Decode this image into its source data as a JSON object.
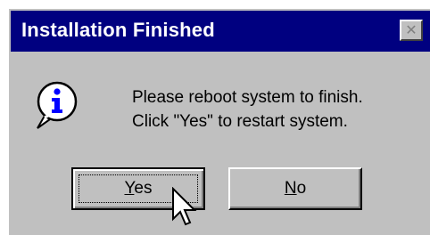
{
  "dialog": {
    "title": "Installation Finished",
    "close_glyph": "✕",
    "icon": "information-icon",
    "message_lines": [
      "Please reboot system to finish.",
      "Click \"Yes\" to restart system."
    ],
    "buttons": {
      "yes": {
        "mnemonic": "Y",
        "rest": "es"
      },
      "no": {
        "mnemonic": "N",
        "rest": "o"
      }
    }
  },
  "colors": {
    "titlebar": "#000080",
    "dialog_face": "#c0c0c0",
    "icon_fill": "#0000ff"
  }
}
